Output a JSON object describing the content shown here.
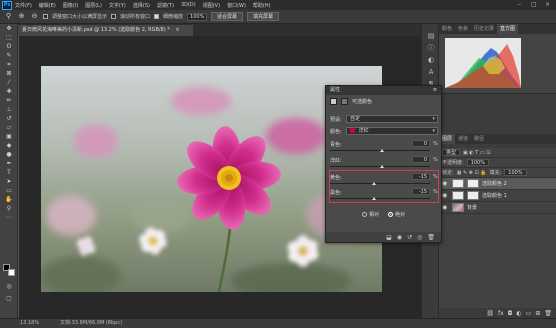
{
  "app": {
    "logo": "Ps"
  },
  "menu": [
    "文件(F)",
    "编辑(E)",
    "图像(I)",
    "图层(L)",
    "文字(Y)",
    "选择(S)",
    "滤镜(T)",
    "3D(D)",
    "视图(V)",
    "窗口(W)",
    "帮助(H)"
  ],
  "options": {
    "scroll_all": "滚动所有窗口",
    "fit_window": "调整窗口大小以满屏显示",
    "scrubby_zoom": "细微缩放",
    "zoom_value": "100%",
    "fit_screen_button": "适合屏幕",
    "fill_screen_button": "填充屏幕"
  },
  "document": {
    "tab_title": "夏日微风花海唯美的小清新.psd @ 13.2% (选取颜色 2, RGB/8) *",
    "close": "×"
  },
  "status": {
    "zoom": "13.18%",
    "doc_info": "文档:33.8M/66.0M (8bpc)"
  },
  "panels": {
    "top_tabs": [
      "颜色",
      "色板",
      "历史记录",
      "直方图"
    ],
    "mid_tabs": [
      "图层",
      "通道",
      "路径"
    ],
    "layers": {
      "kind": "类型",
      "opacity_label": "不透明度:",
      "opacity": "100%",
      "fill_label": "填充:",
      "fill": "100%",
      "lock_label": "锁定:",
      "rows": [
        {
          "name": "选取颜色 2",
          "selected": true,
          "type": "adjust"
        },
        {
          "name": "选取颜色 1",
          "selected": false,
          "type": "adjust"
        },
        {
          "name": "背景",
          "selected": false,
          "type": "photo"
        }
      ]
    }
  },
  "properties": {
    "title": "属性",
    "subtitle": "可选颜色",
    "preset_label": "预设:",
    "preset_value": "自定",
    "color_label": "颜色:",
    "color_value": "洋红",
    "color_swatch": "#c3093a",
    "sliders": [
      {
        "label": "青色:",
        "value": "0"
      },
      {
        "label": "洋红:",
        "value": "0"
      },
      {
        "label": "黄色:",
        "value": "-15"
      },
      {
        "label": "黑色:",
        "value": "-15"
      }
    ],
    "percent": "%",
    "radio_relative": "相对",
    "radio_absolute": "绝对",
    "highlight_color": "#d0404a"
  }
}
